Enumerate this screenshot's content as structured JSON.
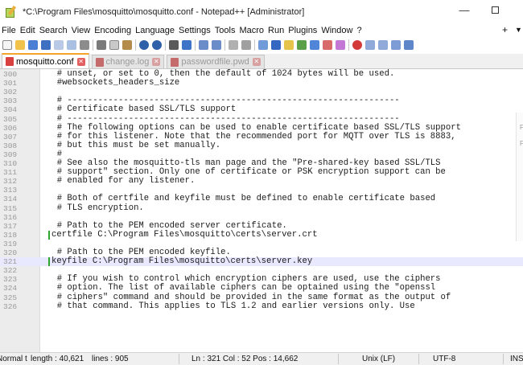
{
  "window": {
    "title": "*C:\\Program Files\\mosquitto\\mosquitto.conf - Notepad++ [Administrator]",
    "minimize": "—",
    "maximize_icon": "maximize-icon"
  },
  "menubar": {
    "items": [
      "File",
      "Edit",
      "Search",
      "View",
      "Encoding",
      "Language",
      "Settings",
      "Tools",
      "Macro",
      "Run",
      "Plugins",
      "Window",
      "?"
    ],
    "right": [
      "+",
      "▼"
    ]
  },
  "toolbar": {
    "icons": [
      "new-file-icon",
      "open-file-icon",
      "save-icon",
      "save-all-icon",
      "close-icon",
      "close-all-icon",
      "print-icon",
      "cut-icon",
      "copy-icon",
      "paste-icon",
      "undo-icon",
      "redo-icon",
      "find-icon",
      "replace-icon",
      "zoom-in-icon",
      "zoom-out-icon",
      "sync-vertical-icon",
      "sync-horizontal-icon",
      "word-wrap-icon",
      "show-all-chars-icon",
      "indent-guide-icon",
      "doc-map-icon",
      "function-list-icon",
      "folder-workspace-icon",
      "monitor-icon",
      "record-macro-icon",
      "stop-macro-icon",
      "play-macro-icon",
      "run-macro-multiple-icon",
      "save-macro-icon"
    ]
  },
  "tabs": [
    {
      "label": "mosquitto.conf",
      "active": true,
      "close": "✕"
    },
    {
      "label": "change.log",
      "active": false,
      "close": "✕"
    },
    {
      "label": "passwordfile.pwd",
      "active": false,
      "close": "✕"
    }
  ],
  "editor": {
    "current_line": 321,
    "lines": [
      {
        "n": "300",
        "text": "  # unset, or set to 0, then the default of 1024 bytes will be used."
      },
      {
        "n": "301",
        "text": "  #websockets_headers_size"
      },
      {
        "n": "302",
        "text": ""
      },
      {
        "n": "303",
        "text": "  # -----------------------------------------------------------------"
      },
      {
        "n": "304",
        "text": "  # Certificate based SSL/TLS support"
      },
      {
        "n": "305",
        "text": "  # -----------------------------------------------------------------"
      },
      {
        "n": "306",
        "text": "  # The following options can be used to enable certificate based SSL/TLS support"
      },
      {
        "n": "307",
        "text": "  # for this listener. Note that the recommended port for MQTT over TLS is 8883,"
      },
      {
        "n": "308",
        "text": "  # but this must be set manually."
      },
      {
        "n": "309",
        "text": "  #"
      },
      {
        "n": "310",
        "text": "  # See also the mosquitto-tls man page and the \"Pre-shared-key based SSL/TLS"
      },
      {
        "n": "311",
        "text": "  # support\" section. Only one of certificate or PSK encryption support can be"
      },
      {
        "n": "312",
        "text": "  # enabled for any listener."
      },
      {
        "n": "313",
        "text": ""
      },
      {
        "n": "314",
        "text": "  # Both of certfile and keyfile must be defined to enable certificate based"
      },
      {
        "n": "315",
        "text": "  # TLS encryption."
      },
      {
        "n": "316",
        "text": ""
      },
      {
        "n": "317",
        "text": "  # Path to the PEM encoded server certificate."
      },
      {
        "n": "318",
        "text": "certfile C:\\Program Files\\mosquitto\\certs\\server.crt",
        "changed": true
      },
      {
        "n": "319",
        "text": ""
      },
      {
        "n": "320",
        "text": "  # Path to the PEM encoded keyfile."
      },
      {
        "n": "321",
        "text": "keyfile C:\\Program Files\\mosquitto\\certs\\server.key",
        "changed": true
      },
      {
        "n": "322",
        "text": ""
      },
      {
        "n": "323",
        "text": "  # If you wish to control which encryption ciphers are used, use the ciphers"
      },
      {
        "n": "324",
        "text": "  # option. The list of available ciphers can be optained using the \"openssl"
      },
      {
        "n": "325",
        "text": "  # ciphers\" command and should be provided in the same format as the output of"
      },
      {
        "n": "326",
        "text": "  # that command. This applies to TLS 1.2 and earlier versions only. Use"
      }
    ]
  },
  "side_panel": {
    "letters": [
      "F",
      "F"
    ]
  },
  "statusbar": {
    "file_type": "Normal t",
    "length": "length : 40,621",
    "lines": "lines : 905",
    "position": "Ln : 321   Col : 52   Pos : 14,662",
    "eol": "Unix (LF)",
    "encoding": "UTF-8",
    "mode": "INS"
  },
  "colors": {
    "active_tab_accent": "#f4a52a",
    "change_marker": "#2ea52e",
    "current_line_bg": "#e8e8ff"
  }
}
